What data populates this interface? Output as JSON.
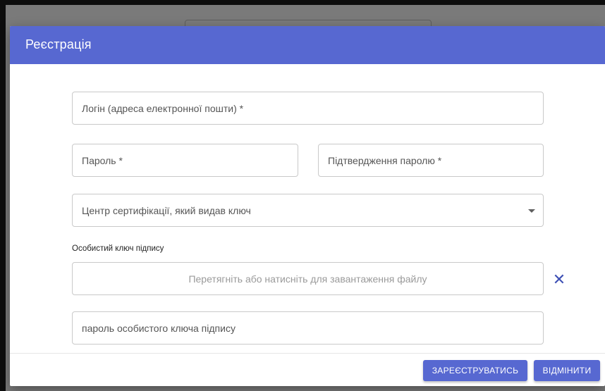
{
  "dialog": {
    "title": "Реєстрація"
  },
  "form": {
    "login_placeholder": "Логін (адреса електронної пошти) *",
    "password_placeholder": "Пароль *",
    "password_confirm_placeholder": "Підтвердження паролю *",
    "ca_select_placeholder": "Центр сертифікації, який видав ключ",
    "key_section_label": "Особистий ключ підпису",
    "dropzone_text": "Перетягніть або натисніть для завантаження файлу",
    "key_password_placeholder": "пароль особистого ключа підпису"
  },
  "icons": {
    "clear": "close-icon",
    "select_arrow": "dropdown-arrow-icon"
  },
  "buttons": {
    "register_label": "ЗАРЕЄСТРУВАТИСЬ",
    "cancel_label": "ВІДМІНИТИ"
  },
  "colors": {
    "accent": "#5768d1",
    "clear_icon": "#3f51b5"
  }
}
